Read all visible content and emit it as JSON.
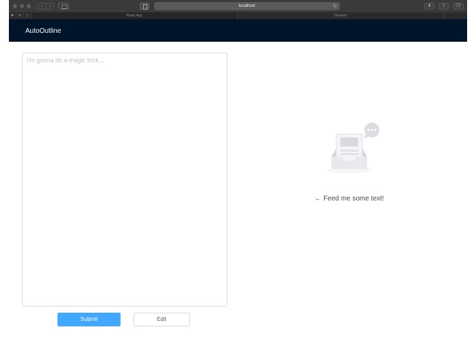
{
  "browser": {
    "url": "localhost",
    "nav_back_glyph": "‹",
    "nav_forward_glyph": "›",
    "reload_glyph": "↻",
    "tabs": [
      {
        "label": "React App"
      },
      {
        "label": "Devpost"
      }
    ],
    "tab_icons": [
      {
        "icon": "bug-icon",
        "glyph": "✱"
      },
      {
        "icon": "mail-icon",
        "glyph": "✉"
      },
      {
        "icon": "circle-icon",
        "glyph": "○"
      }
    ],
    "right_buttons": [
      {
        "icon": "download-icon",
        "glyph": "⬇"
      },
      {
        "icon": "share-icon",
        "glyph": "⇪"
      },
      {
        "icon": "tabs-icon",
        "glyph": "❐"
      }
    ]
  },
  "app": {
    "title": "AutoOutline",
    "input": {
      "value": "",
      "placeholder": "I'm gonna do a magic trick..."
    },
    "submit_label": "Submit",
    "edit_label": "Edit",
    "empty_message": "← Feed me some text!"
  },
  "colors": {
    "header_bg": "#001529",
    "primary": "#40a9ff",
    "border": "#d9d9d9"
  }
}
